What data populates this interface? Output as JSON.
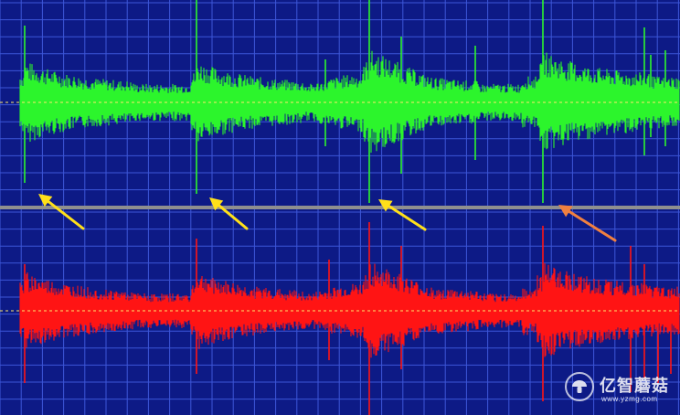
{
  "colors": {
    "background": "#0d1a86",
    "grid": "#3d56d8",
    "left_channel": "#2cf52c",
    "right_channel": "#ff1414",
    "center_line": "#ffe86b",
    "divider": "#8f8f8f",
    "arrow_yellow": "#ffe01a",
    "arrow_orange": "#f08040"
  },
  "channels": [
    {
      "name": "left-channel",
      "color_key": "left_channel"
    },
    {
      "name": "right-channel",
      "color_key": "right_channel"
    }
  ],
  "annotations": [
    {
      "name": "yellow-arrow-1",
      "color_key": "arrow_yellow"
    },
    {
      "name": "yellow-arrow-2",
      "color_key": "arrow_yellow"
    },
    {
      "name": "yellow-arrow-3",
      "color_key": "arrow_yellow"
    },
    {
      "name": "orange-arrow",
      "color_key": "arrow_orange"
    }
  ],
  "watermark": {
    "name": "亿智蘑菇",
    "url": "www.yzmg.com",
    "icon": "mushroom-icon"
  }
}
